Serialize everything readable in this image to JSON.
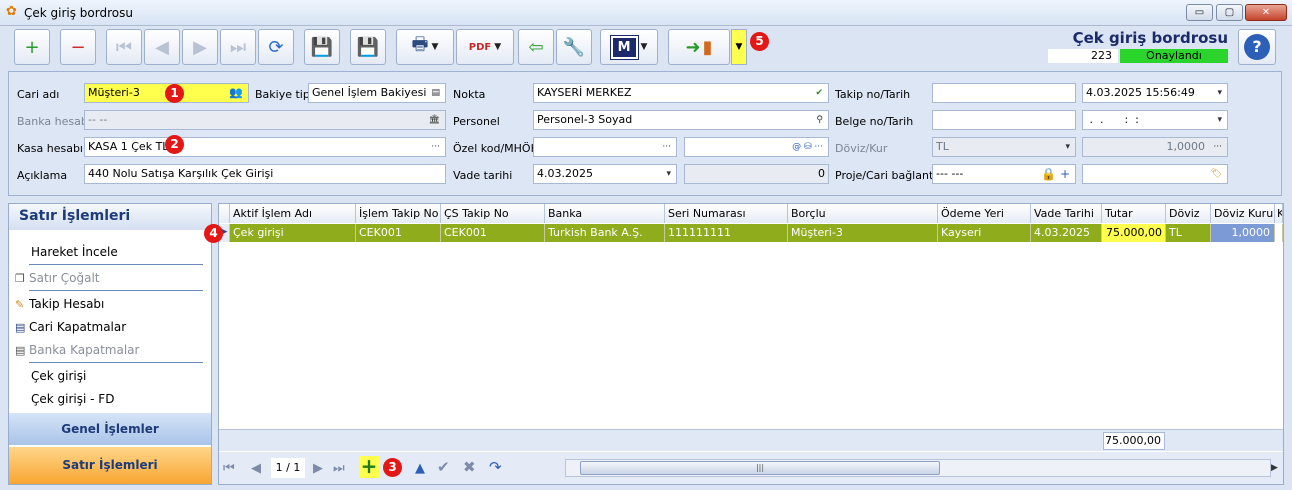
{
  "window": {
    "title": "Çek giriş bordrosu",
    "minimize": "▭",
    "maximize": "▢",
    "close": "✕"
  },
  "header": {
    "title": "Çek giriş bordrosu",
    "number": "223",
    "status": "Onaylandı"
  },
  "toolbar": {
    "new_icon": "+",
    "delete_icon": "−",
    "first_icon": "⏮",
    "prev_icon": "◀",
    "next_icon": "▶",
    "last_icon": "⏭",
    "refresh_icon": "⟳",
    "save_icon": "💾",
    "cancel_save_icon": "💾",
    "print_icon": "🖶",
    "pdf_icon": "PDF",
    "import_icon": "⇦",
    "tools_icon": "🔧",
    "m_label": "M",
    "exit_icon": "➜",
    "help_icon": "?"
  },
  "form": {
    "cari_adi": {
      "label": "Cari adı",
      "value": "Müşteri-3"
    },
    "bakiye_tipi": {
      "label": "Bakiye tipi",
      "value": "Genel İşlem Bakiyesi"
    },
    "nokta": {
      "label": "Nokta",
      "value": "KAYSERİ MERKEZ"
    },
    "takip_no": {
      "label": "Takip no/Tarih",
      "value": "",
      "date": "4.03.2025 15:56:49"
    },
    "banka_hesabi": {
      "label": "Banka hesabı",
      "value": "-- --"
    },
    "personel": {
      "label": "Personel",
      "value": "Personel-3 Soyad"
    },
    "belge_no": {
      "label": "Belge no/Tarih",
      "value": "",
      "date": " .  .      :  :"
    },
    "kasa_hesabi": {
      "label": "Kasa hesabı",
      "value": "KASA 1 Çek TL"
    },
    "ozel_kod": {
      "label": "Özel kod/MHÖK",
      "value": "",
      "value2": ""
    },
    "doviz_kur": {
      "label": "Döviz/Kur",
      "currency": "TL",
      "rate": "1,0000"
    },
    "aciklama": {
      "label": "Açıklama",
      "value": "440 Nolu Satışa Karşılık Çek Girişi"
    },
    "vade_tarihi": {
      "label": "Vade tarihi",
      "value": "4.03.2025",
      "days": "0"
    },
    "proje": {
      "label": "Proje/Cari bağlantı",
      "value": "--- ---",
      "value2": ""
    }
  },
  "badges": [
    "1",
    "2",
    "3",
    "4",
    "5"
  ],
  "left_panel": {
    "title": "Satır İşlemleri",
    "items": [
      {
        "label": "Hareket İncele",
        "icon": "",
        "enabled": true
      },
      {
        "label": "Satır Çoğalt",
        "icon": "❐",
        "enabled": false
      },
      {
        "label": "Takip Hesabı",
        "icon": "✎",
        "enabled": true
      },
      {
        "label": "Cari Kapatmalar",
        "icon": "▤",
        "enabled": true
      },
      {
        "label": "Banka Kapatmalar",
        "icon": "▤",
        "enabled": false
      },
      {
        "label": "Çek girişi",
        "icon": "",
        "enabled": true
      },
      {
        "label": "Çek girişi - FD",
        "icon": "",
        "enabled": true
      }
    ],
    "genel_btn": "Genel İşlemler",
    "satir_btn": "Satır İşlemleri"
  },
  "grid": {
    "columns": [
      "Aktif İşlem Adı",
      "İşlem Takip No",
      "ÇS Takip No",
      "Banka",
      "Seri Numarası",
      "Borçlu",
      "Ödeme Yeri",
      "Vade Tarihi",
      "Tutar",
      "Döviz",
      "Döviz Kuru",
      "K"
    ],
    "rows": [
      [
        "Çek girişi",
        "CEK001",
        "CEK001",
        "Turkish Bank A.Ş.",
        "111111111",
        "Müşteri-3",
        "Kayseri",
        "4.03.2025",
        "75.000,00",
        "TL",
        "1,0000",
        ""
      ]
    ],
    "total": "75.000,00",
    "page": "1 / 1"
  },
  "colors": {
    "row_bg": "#8fac1c",
    "row_text": "#ffffff",
    "highlight": "#ffff4d",
    "status": "#2bd42b",
    "badge": "#e41616"
  }
}
